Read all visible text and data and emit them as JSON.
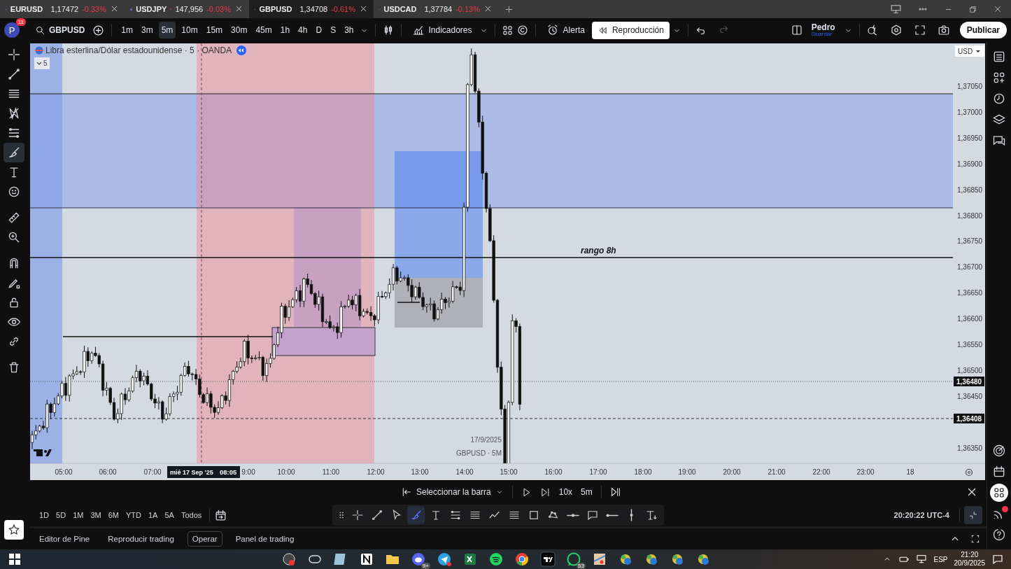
{
  "browser_tabs": [
    {
      "symbol": "EURUSD",
      "price": "1,17472",
      "change": "-0.33%",
      "selected": false
    },
    {
      "symbol": "USDJPY",
      "price": "147,956",
      "change": "-0.03%",
      "selected": false
    },
    {
      "symbol": "GBPUSD",
      "price": "1,34708",
      "change": "-0.61%",
      "selected": true
    },
    {
      "symbol": "USDCAD",
      "price": "1,37784",
      "change": "-0.13%",
      "selected": false
    }
  ],
  "toolbar": {
    "avatar": "P",
    "notifications": "11",
    "symbol": "GBPUSD",
    "intervals": [
      {
        "label": "1m",
        "selected": false
      },
      {
        "label": "3m",
        "selected": false
      },
      {
        "label": "5m",
        "selected": true
      },
      {
        "label": "10m",
        "selected": false
      },
      {
        "label": "15m",
        "selected": false
      },
      {
        "label": "30m",
        "selected": false
      },
      {
        "label": "45m",
        "selected": false
      },
      {
        "label": "1h",
        "selected": false
      },
      {
        "label": "4h",
        "selected": false
      },
      {
        "label": "D",
        "selected": false
      },
      {
        "label": "S",
        "selected": false
      },
      {
        "label": "3h",
        "selected": false
      }
    ],
    "indicators": "Indicadores",
    "alert": "Alerta",
    "replay": "Reproducción",
    "user_name": "Pedro",
    "user_action": "Guardar",
    "publish": "Publicar"
  },
  "left_tools": [
    {
      "selected": false
    },
    {
      "selected": false
    },
    {
      "selected": false
    },
    {
      "selected": false
    },
    {
      "selected": false
    },
    {
      "selected": true
    },
    {
      "selected": false
    },
    {
      "selected": false
    },
    {
      "selected": false
    },
    {
      "selected": false
    },
    {
      "selected": false
    },
    {
      "selected": false
    },
    {
      "selected": false
    },
    {
      "selected": false
    },
    {
      "selected": false
    },
    {
      "selected": false
    }
  ],
  "chart": {
    "title": "Libra esterlina/Dólar estadounidense · 5 · OANDA",
    "legend_toggle": "5",
    "annotation": "rango 8h",
    "replay_date": "17/9/2025",
    "replay_symbol": "GBPUSD · 5M",
    "currency": "USD",
    "price_ticks": [
      "1,37050",
      "1,37000",
      "1,36950",
      "1,36900",
      "1,36850",
      "1,36800",
      "1,36750",
      "1,36700",
      "1,36650",
      "1,36600",
      "1,36550",
      "1,36500",
      "1,36450",
      "1,36350"
    ],
    "price_labels": [
      "1,36480",
      "1,36408"
    ],
    "time_ticks": [
      "05:00",
      "06:00",
      "07:00",
      "9:00",
      "10:00",
      "11:00",
      "12:00",
      "13:00",
      "14:00",
      "15:00",
      "16:00",
      "17:00",
      "18:00",
      "19:00",
      "20:00",
      "21:00",
      "22:00",
      "23:00",
      "18"
    ],
    "crosshair_date": "mié 17 Sep '25",
    "crosshair_time": "08:05"
  },
  "replay_bar": {
    "select": "Seleccionar la barra",
    "speed": "10x",
    "interval": "5m"
  },
  "ranges": [
    "1D",
    "5D",
    "1M",
    "3M",
    "6M",
    "YTD",
    "1A",
    "5A",
    "Todos"
  ],
  "drawing_toolbar": [
    {
      "selected": false
    },
    {
      "selected": false
    },
    {
      "selected": false
    },
    {
      "selected": true
    },
    {
      "selected": false
    },
    {
      "selected": false
    },
    {
      "selected": false
    },
    {
      "selected": false
    },
    {
      "selected": false
    },
    {
      "selected": false
    },
    {
      "selected": false
    },
    {
      "selected": false
    },
    {
      "selected": false
    },
    {
      "selected": false
    },
    {
      "selected": false
    }
  ],
  "clock": "20:20:22 UTC-4",
  "panel_tabs": [
    {
      "label": "Editor de Pine",
      "selected": false
    },
    {
      "label": "Reproducir trading",
      "selected": false
    },
    {
      "label": "Operar",
      "selected": true
    },
    {
      "label": "Panel de trading",
      "selected": false
    }
  ],
  "taskbar": {
    "whatsapp_count": "53",
    "discord_count": "9+",
    "language": "ESP",
    "time": "21:20",
    "date": "20/9/2025"
  }
}
